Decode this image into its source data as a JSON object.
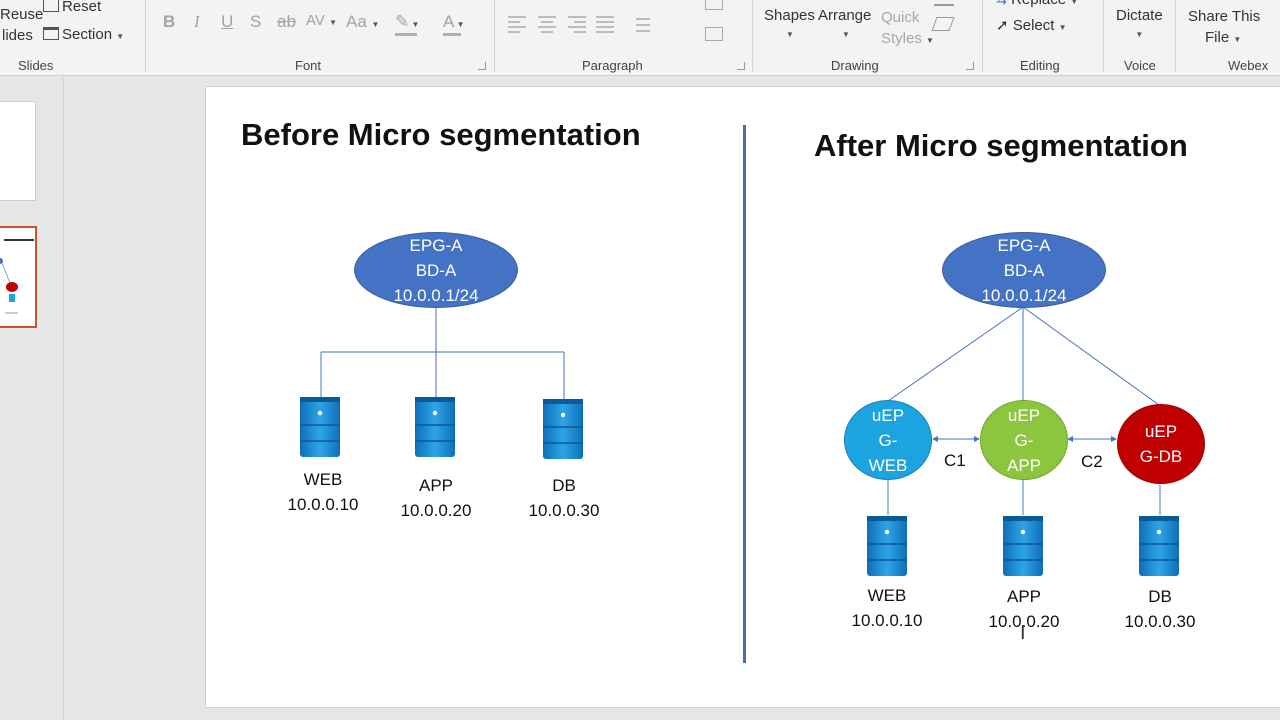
{
  "ribbon": {
    "slides_group": {
      "reuse": "Reuse",
      "slides": "lides",
      "reset": "Reset",
      "section": "Section",
      "label": "Slides"
    },
    "font_group": {
      "label": "Font",
      "buttons": [
        "B",
        "I",
        "U",
        "S",
        "ab",
        "AV",
        "Aa",
        "A",
        "A"
      ]
    },
    "paragraph_group": {
      "label": "Paragraph"
    },
    "drawing_group": {
      "shapes": "Shapes",
      "arrange": "Arrange",
      "quick": "Quick",
      "styles": "Styles",
      "label": "Drawing"
    },
    "editing_group": {
      "replace": "Replace",
      "select": "Select",
      "label": "Editing"
    },
    "voice_group": {
      "dictate": "Dictate",
      "label": "Voice"
    },
    "webex_group": {
      "share_line1": "Share This",
      "share_line2": "File",
      "label": "Webex"
    }
  },
  "slide": {
    "left": {
      "title": "Before Micro segmentation",
      "epg": {
        "line1": "EPG-A",
        "line2": "BD-A",
        "line3": "10.0.0.1/24"
      },
      "servers": [
        {
          "name": "WEB",
          "ip": "10.0.0.10"
        },
        {
          "name": "APP",
          "ip": "10.0.0.20"
        },
        {
          "name": "DB",
          "ip": "10.0.0.30"
        }
      ]
    },
    "right": {
      "title": "After Micro segmentation",
      "epg": {
        "line1": "EPG-A",
        "line2": "BD-A",
        "line3": "10.0.0.1/24"
      },
      "useg": [
        {
          "line1": "uEP",
          "line2": "G-",
          "line3": "WEB"
        },
        {
          "line1": "uEP",
          "line2": "G-",
          "line3": "APP"
        },
        {
          "line1": "uEP",
          "line2": "G-DB"
        }
      ],
      "contracts": [
        "C1",
        "C2"
      ],
      "servers": [
        {
          "name": "WEB",
          "ip": "10.0.0.10"
        },
        {
          "name": "APP",
          "ip": "10.0.0.20"
        },
        {
          "name": "DB",
          "ip": "10.0.0.30"
        }
      ]
    }
  },
  "colors": {
    "epg": "#4472c4",
    "web": "#1ca4e0",
    "app": "#8cc63f",
    "db": "#c00000",
    "divider": "#4a6ea8"
  }
}
